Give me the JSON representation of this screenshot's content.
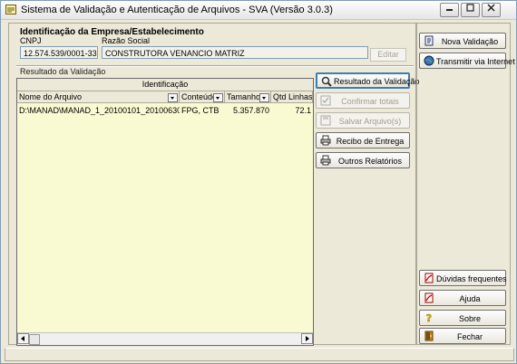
{
  "window": {
    "title": "Sistema de Validação e Autenticação de Arquivos - SVA (Versão 3.0.3)"
  },
  "company": {
    "section_title": "Identificação da Empresa/Estabelecimento",
    "cnpj_label": "CNPJ",
    "cnpj_value": "12.574.539/0001-33",
    "razao_label": "Razão Social",
    "razao_value": "CONSTRUTORA VENANCIO MATRIZ",
    "edit_label": "Editar"
  },
  "result": {
    "section_label": "Resultado da Validação",
    "group_header": "Identificação",
    "columns": [
      "Nome do Arquivo",
      "Conteúdo",
      "Tamanho",
      "Qtd Linhas"
    ],
    "rows": [
      [
        "D:\\MANAD\\MANAD_1_20100101_20100630.txt",
        "FPG, CTB",
        "5.357.870",
        "72.1"
      ]
    ]
  },
  "actions": {
    "resultado": "Resultado da Validação",
    "confirmar": "Confirmar totais",
    "salvar": "Salvar Arquivo(s)",
    "recibo": "Recibo de Entrega",
    "outros": "Outros Relatórios"
  },
  "side": {
    "nova": "Nova Validação",
    "transmitir": "Transmitir via Internet",
    "duvidas": "Dúvidas frequentes",
    "ajuda": "Ajuda",
    "sobre": "Sobre",
    "fechar": "Fechar"
  },
  "icons": {
    "app": "app-icon",
    "minimize": "minimize-icon",
    "maximize": "maximize-icon",
    "close": "close-icon",
    "search": "magnifier-icon",
    "confirm": "check-icon",
    "save": "floppy-icon",
    "print": "printer-icon",
    "new": "document-icon",
    "transmit": "globe-icon",
    "pdf": "pdf-icon",
    "help": "question-icon",
    "exit": "door-icon"
  },
  "colors": {
    "grid_background": "#fafad2",
    "window_background": "#ece9d8",
    "active_border": "#3c7fb1"
  }
}
